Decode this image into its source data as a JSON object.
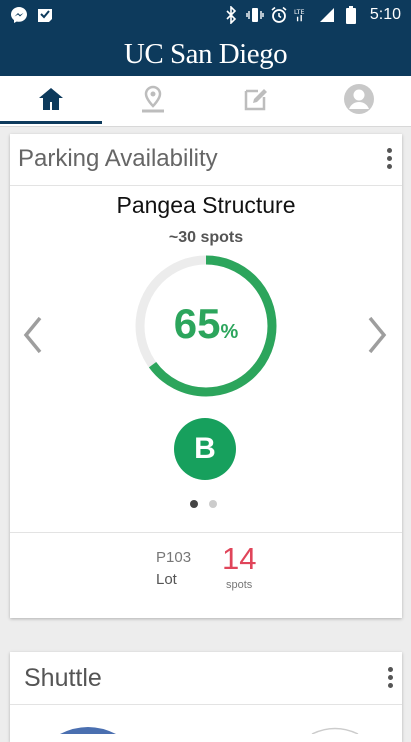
{
  "status_bar": {
    "time": "5:10",
    "left_icons": [
      "messenger-icon",
      "check-icon"
    ],
    "right_icons": [
      "bluetooth-icon",
      "vibrate-icon",
      "alarm-icon",
      "lte-icon",
      "signal-icon",
      "battery-icon"
    ]
  },
  "header": {
    "title": "UC San Diego"
  },
  "tabs": [
    {
      "name": "home",
      "icon": "home-icon",
      "active": true
    },
    {
      "name": "map",
      "icon": "map-pin-icon",
      "active": false
    },
    {
      "name": "feedback",
      "icon": "edit-icon",
      "active": false
    },
    {
      "name": "profile",
      "icon": "user-icon",
      "active": false
    }
  ],
  "parking": {
    "title": "Parking Availability",
    "structure": "Pangea Structure",
    "spots_approx": "~30 spots",
    "percent": 65,
    "percent_unit": "%",
    "permit": "B",
    "page_count": 2,
    "active_page": 0,
    "lot_code": "P103",
    "lot_type": "Lot",
    "lot_spots": "14",
    "lot_spots_label": "spots"
  },
  "shuttle": {
    "title": "Shuttle"
  },
  "colors": {
    "brand": "#0d3a5c",
    "gauge": "#2ca55c",
    "badge": "#17a05d",
    "spots": "#e0455a"
  }
}
